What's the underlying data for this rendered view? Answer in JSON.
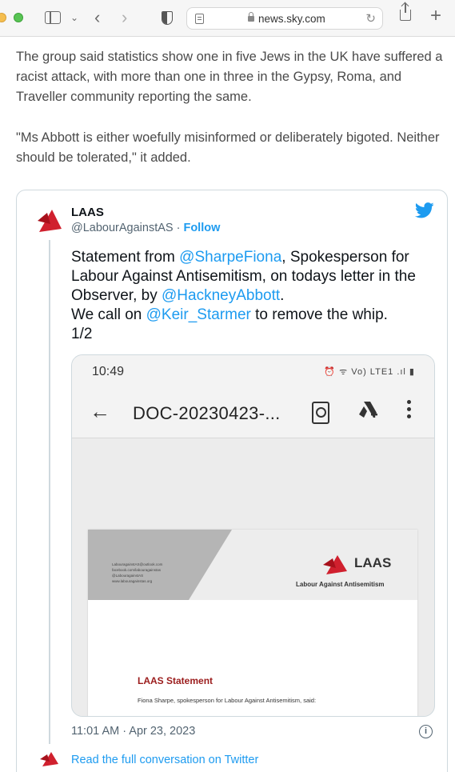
{
  "browser": {
    "url": "news.sky.com"
  },
  "article": {
    "paragraphs": [
      "The group said statistics show one in five Jews in the UK have suffered a racist attack, with more than one in three in the Gypsy, Roma, and Traveller community reporting the same.",
      "\"Ms Abbott is either woefully misinformed or deliberately bigoted. Neither should be tolerated,\" it added."
    ]
  },
  "tweet": {
    "name": "LAAS",
    "handle": "@LabourAgainstAS",
    "separator": " · ",
    "follow_label": "Follow",
    "body": {
      "t1": "Statement from ",
      "m1": "@SharpeFiona",
      "t2": ", Spokesperson for Labour Against Antisemitism, on todays letter in the Observer, by ",
      "m2": "@HackneyAbbott",
      "t3": ".",
      "t4": "We call on ",
      "m3": "@Keir_Starmer",
      "t5": " to remove the whip.",
      "t6": "1/2"
    },
    "timestamp": "11:01 AM · Apr 23, 2023",
    "read_more": "Read the full conversation on Twitter",
    "accent_color": "#1d9bf0"
  },
  "media": {
    "phone_time": "10:49",
    "status_icons": "⏰ ᯤ Vo) LTE1 .ıl ▮",
    "doc_title": "DOC-20230423-...",
    "doc": {
      "contact_lines": [
        "LabouragainstAS@outlook.com",
        "facebook.com/labouragainstas",
        "@LabouragainstAS",
        "www.labouragainstas.org"
      ],
      "brand": "LAAS",
      "brand_sub": "Labour Against Antisemitism",
      "heading": "LAAS Statement",
      "text": "Fiona Sharpe, spokesperson for Labour Against Antisemitism, said:",
      "heading_color": "#9b1c1c",
      "logo_color": "#d0202e"
    }
  }
}
